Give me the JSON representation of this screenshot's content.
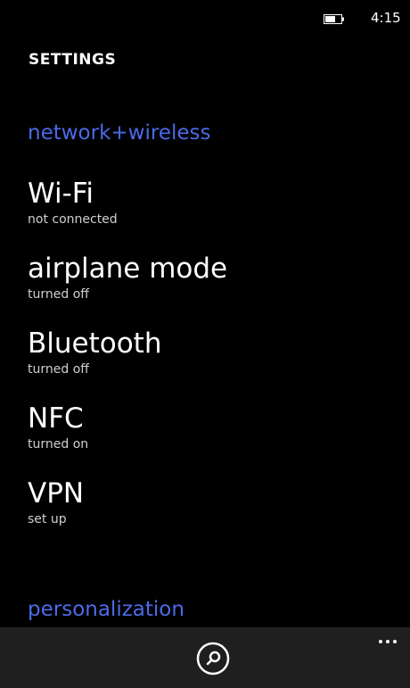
{
  "status_bar": {
    "time": "4:15",
    "battery_icon": "battery-icon"
  },
  "header": {
    "title": "SETTINGS"
  },
  "sections": {
    "network": {
      "label": "network+wireless"
    },
    "personalization": {
      "label": "personalization"
    }
  },
  "items": [
    {
      "title": "Wi-Fi",
      "subtitle": "not connected"
    },
    {
      "title": "airplane mode",
      "subtitle": "turned off"
    },
    {
      "title": "Bluetooth",
      "subtitle": "turned off"
    },
    {
      "title": "NFC",
      "subtitle": "turned on"
    },
    {
      "title": "VPN",
      "subtitle": "set up"
    }
  ],
  "app_bar": {
    "search_icon": "search-icon",
    "more_icon": "more-icon"
  },
  "colors": {
    "accent": "#4b6ae8",
    "background": "#000000",
    "app_bar_background": "#1f1f1f"
  }
}
